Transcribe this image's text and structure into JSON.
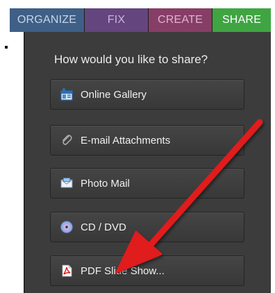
{
  "tabs": {
    "organize": "ORGANIZE",
    "fix": "FIX",
    "create": "CREATE",
    "share": "SHARE",
    "active": "SHARE"
  },
  "share_panel": {
    "prompt": "How would you like to share?",
    "options": [
      {
        "label": "Online Gallery",
        "icon": "gallery-icon"
      },
      {
        "label": "E-mail Attachments",
        "icon": "paperclip-icon"
      },
      {
        "label": "Photo Mail",
        "icon": "envelope-icon"
      },
      {
        "label": "CD / DVD",
        "icon": "disc-icon"
      },
      {
        "label": "PDF Slide Show...",
        "icon": "pdf-icon"
      }
    ]
  },
  "annotation": {
    "type": "red-arrow",
    "points_to": "PDF Slide Show...",
    "color": "#e01b1b"
  },
  "colors": {
    "organize_tab": "#3f5f86",
    "fix_tab": "#65457e",
    "create_tab": "#873e66",
    "share_tab": "#3fa542",
    "panel_bg": "#3c3c3c"
  }
}
